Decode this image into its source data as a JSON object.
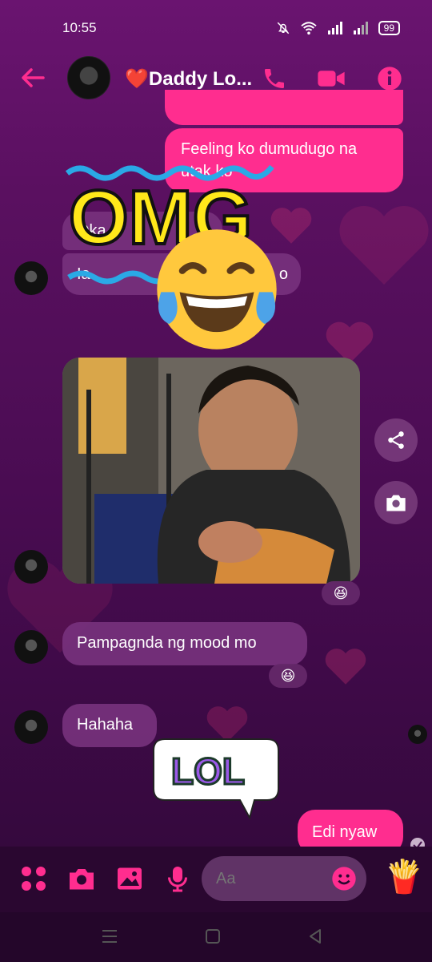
{
  "status_bar": {
    "time": "10:55",
    "battery": "99"
  },
  "header": {
    "contact_name": "❤️Daddy Lo..."
  },
  "messages": {
    "out_partial": "...",
    "out_1": "Feeling ko dumudugo na utak ko",
    "in_partial_1": "Oka",
    "in_partial_2": "Ia",
    "in_partial_2_tail": "o",
    "in_mood": "Pampagnda ng mood mo",
    "in_hahaha": "Hahaha",
    "out_edi": "Edi nyaw"
  },
  "reactions": {
    "photo_reaction": "😆",
    "mood_reaction": "😆"
  },
  "stickers": {
    "omg_text": "OMG",
    "lol_text": "LOL",
    "laugh_emoji": "😂"
  },
  "composer": {
    "placeholder": "Aa",
    "sticker_emoji": "🍟"
  },
  "colors": {
    "accent": "#ff2d8f",
    "incoming_bubble": "#78327d"
  }
}
